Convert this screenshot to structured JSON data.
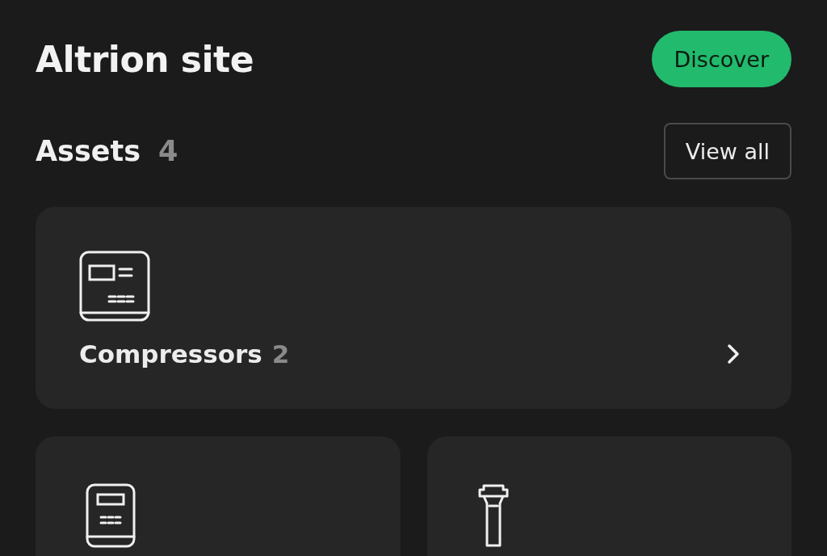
{
  "header": {
    "title": "Altrion site",
    "action": "Discover"
  },
  "section": {
    "title": "Assets",
    "count": "4",
    "action": "View all"
  },
  "cards": [
    {
      "kind": "panel",
      "name": "Compressors",
      "count": "2"
    },
    {
      "kind": "cabinet"
    },
    {
      "kind": "post"
    }
  ]
}
